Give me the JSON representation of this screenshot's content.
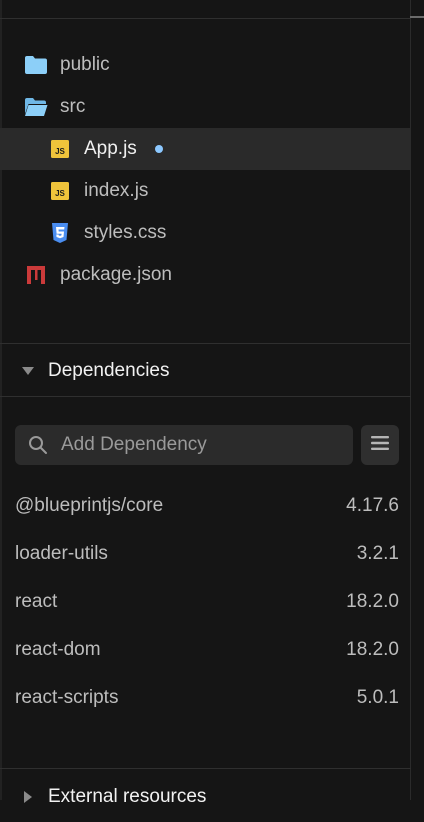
{
  "files": [
    {
      "name": "public",
      "type": "folder",
      "icon": "folder-icon",
      "open": false,
      "active": false,
      "modified": false,
      "level": 0
    },
    {
      "name": "src",
      "type": "folder",
      "icon": "folder-open-icon",
      "open": true,
      "active": false,
      "modified": false,
      "level": 0
    },
    {
      "name": "App.js",
      "type": "js",
      "icon": "js-file-icon",
      "active": true,
      "modified": true,
      "level": 1
    },
    {
      "name": "index.js",
      "type": "js",
      "icon": "js-file-icon",
      "active": false,
      "modified": false,
      "level": 1
    },
    {
      "name": "styles.css",
      "type": "css",
      "icon": "css-file-icon",
      "active": false,
      "modified": false,
      "level": 1
    },
    {
      "name": "package.json",
      "type": "npm",
      "icon": "npm-file-icon",
      "active": false,
      "modified": false,
      "level": 0
    }
  ],
  "dependencies_section": {
    "title": "Dependencies",
    "search_placeholder": "Add Dependency",
    "items": [
      {
        "name": "@blueprintjs/core",
        "version": "4.17.6"
      },
      {
        "name": "loader-utils",
        "version": "3.2.1"
      },
      {
        "name": "react",
        "version": "18.2.0"
      },
      {
        "name": "react-dom",
        "version": "18.2.0"
      },
      {
        "name": "react-scripts",
        "version": "5.0.1"
      }
    ]
  },
  "external_section": {
    "title": "External resources"
  },
  "colors": {
    "background": "#151515",
    "active_row": "#2a2a2a",
    "folder": "#8ccff8",
    "js_badge": "#f0c43b",
    "css_icon": "#4a8df0",
    "npm_icon": "#cb3a3a",
    "modified_dot": "#8cc8ff"
  }
}
